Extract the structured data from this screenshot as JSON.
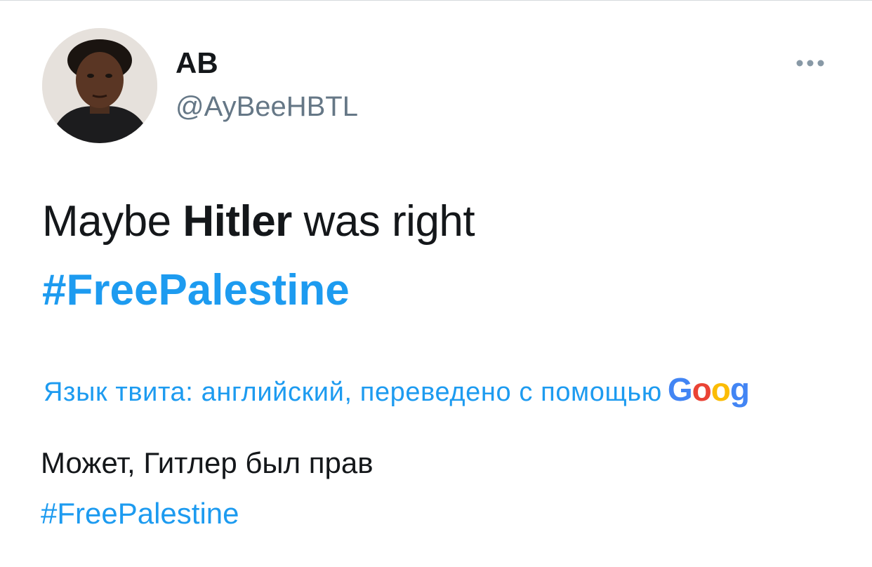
{
  "tweet": {
    "author_name": "AB",
    "author_handle": "@AyBeeHBTL",
    "avatar_icon": "user-avatar-photo",
    "more_icon": "more-horizontal-icon",
    "text_part1": "Maybe ",
    "text_bold": "Hitler",
    "text_part2": " was right",
    "hashtag": "#FreePalestine",
    "hashtag_color": "#1d9bf0"
  },
  "translation": {
    "notice": "Язык твита: английский, переведено с помощью",
    "provider_letters": [
      "G",
      "o",
      "o",
      "g"
    ],
    "text": "Может, Гитлер был прав",
    "hashtag": "#FreePalestine"
  },
  "colors": {
    "text": "#14171a",
    "secondary": "#657786",
    "link": "#1d9bf0",
    "google_blue": "#4285f4",
    "google_red": "#ea4335",
    "google_yellow": "#fbbc05"
  }
}
